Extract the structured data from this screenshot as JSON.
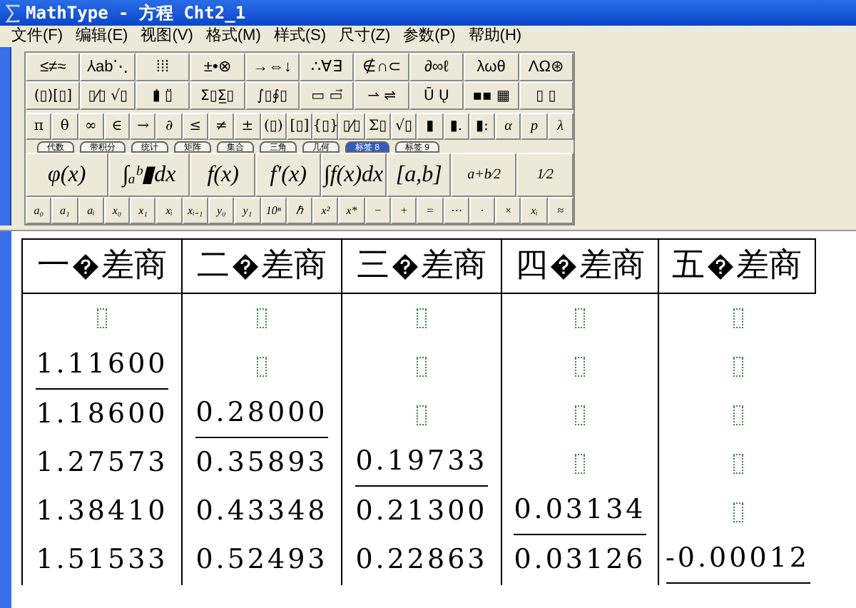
{
  "window": {
    "title": "MathType - 方程 Cht2_1"
  },
  "menu": [
    "文件(F)",
    "编辑(E)",
    "视图(V)",
    "格式(M)",
    "样式(S)",
    "尺寸(Z)",
    "参数(P)",
    "帮助(H)"
  ],
  "symbol_palettes": [
    "≤≠≈",
    "⅄ab⋱",
    "⁞⁞⁞",
    "±•⊗",
    "→⇔↓",
    "∴∀∃",
    "∉∩⊂",
    "∂∞ℓ",
    "λωθ",
    "ΛΩ⊛"
  ],
  "template_palettes": [
    "(▯)[▯]",
    "▯⁄▯ √▯",
    "▮̇ ▯̈",
    "Σ▯Σ̲▯",
    "∫▯∮▯",
    "▭ ▭⃗",
    "⇀ ⇌",
    "Ū Ų",
    "▪▪ ▦",
    "▯ ▯"
  ],
  "small_bar": [
    "π",
    "θ",
    "∞",
    "∈",
    "→",
    "∂",
    "≤",
    "≠",
    "±",
    "(▯)",
    "[▯]",
    "{▯}",
    "▯⁄▯",
    "Σ▯",
    "√▯",
    "▮",
    "▮.",
    "▮:",
    "α",
    "p",
    "λ"
  ],
  "tabs": [
    {
      "label": "代数",
      "selected": false
    },
    {
      "label": "带积分",
      "selected": false
    },
    {
      "label": "统计",
      "selected": false
    },
    {
      "label": "矩阵",
      "selected": false
    },
    {
      "label": "集合",
      "selected": false
    },
    {
      "label": "三角",
      "selected": false
    },
    {
      "label": "几何",
      "selected": false
    },
    {
      "label": "标签 8",
      "selected": true
    },
    {
      "label": "标签 9",
      "selected": false
    }
  ],
  "expression_bar": [
    "φ(x)",
    "∫ₐᵇ▮dx",
    "f(x)",
    "f′(x)",
    "∫f(x)dx",
    "[a,b]",
    "a+b⁄2",
    "1⁄2"
  ],
  "subscript_bar": [
    "a₀",
    "a₁",
    "aᵢ",
    "x₀",
    "x₁",
    "xᵢ",
    "xᵢ₋₁",
    "y₀",
    "y₁",
    "10ⁿ",
    "ℏ",
    "x²",
    "x*",
    "−",
    "+",
    "=",
    "⋯",
    "·",
    "×",
    "xᵢ",
    "≈"
  ],
  "table": {
    "columns": [
      {
        "numeral": "一",
        "label": "差商"
      },
      {
        "numeral": "二",
        "label": "差商"
      },
      {
        "numeral": "三",
        "label": "差商"
      },
      {
        "numeral": "四",
        "label": "差商"
      },
      {
        "numeral": "五",
        "label": "差商"
      }
    ],
    "rows": [
      [
        {
          "kind": "placeholder"
        },
        {
          "kind": "placeholder"
        },
        {
          "kind": "placeholder"
        },
        {
          "kind": "placeholder"
        },
        {
          "kind": "placeholder"
        }
      ],
      [
        {
          "kind": "value",
          "text": "1.11600",
          "underlined": true
        },
        {
          "kind": "placeholder"
        },
        {
          "kind": "placeholder"
        },
        {
          "kind": "placeholder"
        },
        {
          "kind": "placeholder"
        }
      ],
      [
        {
          "kind": "value",
          "text": "1.18600",
          "underlined": false
        },
        {
          "kind": "value",
          "text": "0.28000",
          "underlined": true
        },
        {
          "kind": "placeholder"
        },
        {
          "kind": "placeholder"
        },
        {
          "kind": "placeholder"
        }
      ],
      [
        {
          "kind": "value",
          "text": "1.27573",
          "underlined": false
        },
        {
          "kind": "value",
          "text": "0.35893",
          "underlined": false
        },
        {
          "kind": "value",
          "text": "0.19733",
          "underlined": true
        },
        {
          "kind": "placeholder"
        },
        {
          "kind": "placeholder"
        }
      ],
      [
        {
          "kind": "value",
          "text": "1.38410",
          "underlined": false
        },
        {
          "kind": "value",
          "text": "0.43348",
          "underlined": false
        },
        {
          "kind": "value",
          "text": "0.21300",
          "underlined": false
        },
        {
          "kind": "value",
          "text": "0.03134",
          "underlined": true
        },
        {
          "kind": "placeholder"
        }
      ],
      [
        {
          "kind": "value",
          "text": "1.51533",
          "underlined": false
        },
        {
          "kind": "value",
          "text": "0.52493",
          "underlined": false
        },
        {
          "kind": "value",
          "text": "0.22863",
          "underlined": false
        },
        {
          "kind": "value",
          "text": "0.03126",
          "underlined": false
        },
        {
          "kind": "value",
          "text": "-0.00012",
          "underlined": true
        }
      ]
    ]
  }
}
